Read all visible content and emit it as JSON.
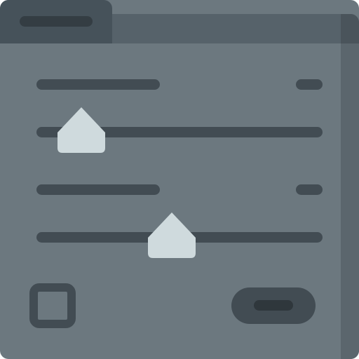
{
  "window": {
    "tab_label": "",
    "colors": {
      "body": "#6c787f",
      "titlebar": "#56626a",
      "tab": "#46525a",
      "control": "#424c53",
      "thumb": "#cfdadd"
    }
  },
  "sliders": [
    {
      "label": "",
      "value_text": "",
      "level": 0.13
    },
    {
      "label": "",
      "value_text": "",
      "level": 0.47
    }
  ],
  "checkbox": {
    "checked": false,
    "icon": "checkbox-icon"
  },
  "action_button": {
    "label": ""
  }
}
